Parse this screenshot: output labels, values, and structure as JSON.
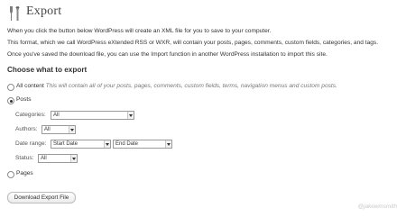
{
  "header": {
    "title": "Export",
    "icon": "tools-icon"
  },
  "intro": {
    "line1": "When you click the button below WordPress will create an XML file for you to save to your computer.",
    "line2": "This format, which we call WordPress eXtended RSS or WXR, will contain your posts, pages, comments, custom fields, categories, and tags.",
    "line3": "Once you've saved the download file, you can use the Import function in another WordPress installation to import this site."
  },
  "section": {
    "heading": "Choose what to export"
  },
  "options": {
    "all_content": {
      "label": "All content",
      "description": "This will contain all of your posts, pages, comments, custom fields, terms, navigation menus and custom posts."
    },
    "posts": {
      "label": "Posts"
    },
    "pages": {
      "label": "Pages"
    }
  },
  "filters": {
    "categories": {
      "label": "Categories:",
      "value": "All"
    },
    "authors": {
      "label": "Authors:",
      "value": "All"
    },
    "date_range": {
      "label": "Date range:",
      "start": "Start Date",
      "end": "End Date"
    },
    "status": {
      "label": "Status:",
      "value": "All"
    }
  },
  "actions": {
    "download_label": "Download Export File"
  },
  "watermark": "@jakewmsmith"
}
